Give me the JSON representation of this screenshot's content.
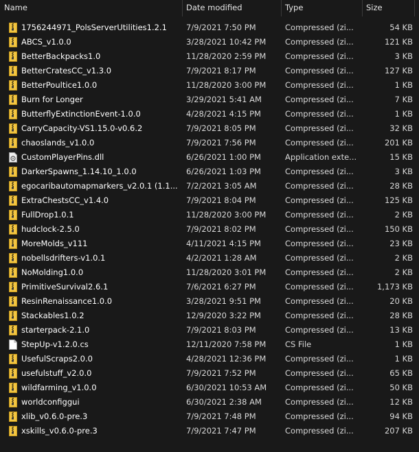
{
  "columns": {
    "name": "Name",
    "date": "Date modified",
    "type": "Type",
    "size": "Size"
  },
  "colors": {
    "background": "#191919",
    "zip_folder_yellow": "#f2c542",
    "zip_folder_dark": "#c99a1c",
    "header_separator": "#3a3a3a"
  },
  "files": [
    {
      "name": "1756244971_PolsServerUtilities1.2.1",
      "date": "7/9/2021 7:50 PM",
      "type": "Compressed (zi...",
      "size": "54 KB",
      "icon": "zip-folder-icon"
    },
    {
      "name": "ABCS_v1.0.0",
      "date": "3/28/2021 10:42 PM",
      "type": "Compressed (zi...",
      "size": "121 KB",
      "icon": "zip-folder-icon"
    },
    {
      "name": "BetterBackpacks1.0",
      "date": "11/28/2020 2:59 PM",
      "type": "Compressed (zi...",
      "size": "3 KB",
      "icon": "zip-folder-icon"
    },
    {
      "name": "BetterCratesCC_v1.3.0",
      "date": "7/9/2021 8:17 PM",
      "type": "Compressed (zi...",
      "size": "127 KB",
      "icon": "zip-folder-icon"
    },
    {
      "name": "BetterPoultice1.0.0",
      "date": "11/28/2020 3:00 PM",
      "type": "Compressed (zi...",
      "size": "1 KB",
      "icon": "zip-folder-icon"
    },
    {
      "name": "Burn for Longer",
      "date": "3/29/2021 5:41 AM",
      "type": "Compressed (zi...",
      "size": "7 KB",
      "icon": "zip-folder-icon"
    },
    {
      "name": "ButterflyExtinctionEvent-1.0.0",
      "date": "4/28/2021 4:15 PM",
      "type": "Compressed (zi...",
      "size": "1 KB",
      "icon": "zip-folder-icon"
    },
    {
      "name": "CarryCapacity-VS1.15.0-v0.6.2",
      "date": "7/9/2021 8:05 PM",
      "type": "Compressed (zi...",
      "size": "32 KB",
      "icon": "zip-folder-icon"
    },
    {
      "name": "chaoslands_v1.0.0",
      "date": "7/9/2021 7:56 PM",
      "type": "Compressed (zi...",
      "size": "201 KB",
      "icon": "zip-folder-icon"
    },
    {
      "name": "CustomPlayerPins.dll",
      "date": "6/26/2021 1:00 PM",
      "type": "Application exte...",
      "size": "15 KB",
      "icon": "dll-file-icon"
    },
    {
      "name": "DarkerSpawns_1.14.10_1.0.0",
      "date": "6/26/2021 1:03 PM",
      "type": "Compressed (zi...",
      "size": "3 KB",
      "icon": "zip-folder-icon"
    },
    {
      "name": "egocaribautomapmarkers_v2.0.1 (1.1...",
      "date": "7/2/2021 3:05 AM",
      "type": "Compressed (zi...",
      "size": "28 KB",
      "icon": "zip-folder-icon"
    },
    {
      "name": "ExtraChestsCC_v1.4.0",
      "date": "7/9/2021 8:04 PM",
      "type": "Compressed (zi...",
      "size": "125 KB",
      "icon": "zip-folder-icon"
    },
    {
      "name": "FullDrop1.0.1",
      "date": "11/28/2020 3:00 PM",
      "type": "Compressed (zi...",
      "size": "2 KB",
      "icon": "zip-folder-icon"
    },
    {
      "name": "hudclock-2.5.0",
      "date": "7/9/2021 8:02 PM",
      "type": "Compressed (zi...",
      "size": "150 KB",
      "icon": "zip-folder-icon"
    },
    {
      "name": "MoreMolds_v111",
      "date": "4/11/2021 4:15 PM",
      "type": "Compressed (zi...",
      "size": "23 KB",
      "icon": "zip-folder-icon"
    },
    {
      "name": "nobellsdrifters-v1.0.1",
      "date": "4/2/2021 1:28 AM",
      "type": "Compressed (zi...",
      "size": "2 KB",
      "icon": "zip-folder-icon"
    },
    {
      "name": "NoMolding1.0.0",
      "date": "11/28/2020 3:01 PM",
      "type": "Compressed (zi...",
      "size": "2 KB",
      "icon": "zip-folder-icon"
    },
    {
      "name": "PrimitiveSurvival2.6.1",
      "date": "7/6/2021 6:27 PM",
      "type": "Compressed (zi...",
      "size": "1,173 KB",
      "icon": "zip-folder-icon"
    },
    {
      "name": "ResinRenaissance1.0.0",
      "date": "3/28/2021 9:51 PM",
      "type": "Compressed (zi...",
      "size": "20 KB",
      "icon": "zip-folder-icon"
    },
    {
      "name": "Stackables1.0.2",
      "date": "12/9/2020 3:22 PM",
      "type": "Compressed (zi...",
      "size": "28 KB",
      "icon": "zip-folder-icon"
    },
    {
      "name": "starterpack-2.1.0",
      "date": "7/9/2021 8:03 PM",
      "type": "Compressed (zi...",
      "size": "13 KB",
      "icon": "zip-folder-icon"
    },
    {
      "name": "StepUp-v1.2.0.cs",
      "date": "12/11/2020 7:58 PM",
      "type": "CS File",
      "size": "1 KB",
      "icon": "cs-file-icon"
    },
    {
      "name": "UsefulScraps2.0.0",
      "date": "4/28/2021 12:36 PM",
      "type": "Compressed (zi...",
      "size": "1 KB",
      "icon": "zip-folder-icon"
    },
    {
      "name": "usefulstuff_v2.0.0",
      "date": "7/9/2021 7:52 PM",
      "type": "Compressed (zi...",
      "size": "65 KB",
      "icon": "zip-folder-icon"
    },
    {
      "name": "wildfarming_v1.0.0",
      "date": "6/30/2021 10:53 AM",
      "type": "Compressed (zi...",
      "size": "50 KB",
      "icon": "zip-folder-icon"
    },
    {
      "name": "worldconfiggui",
      "date": "6/30/2021 2:38 AM",
      "type": "Compressed (zi...",
      "size": "12 KB",
      "icon": "zip-folder-icon"
    },
    {
      "name": "xlib_v0.6.0-pre.3",
      "date": "7/9/2021 7:48 PM",
      "type": "Compressed (zi...",
      "size": "94 KB",
      "icon": "zip-folder-icon"
    },
    {
      "name": "xskills_v0.6.0-pre.3",
      "date": "7/9/2021 7:47 PM",
      "type": "Compressed (zi...",
      "size": "207 KB",
      "icon": "zip-folder-icon"
    }
  ]
}
